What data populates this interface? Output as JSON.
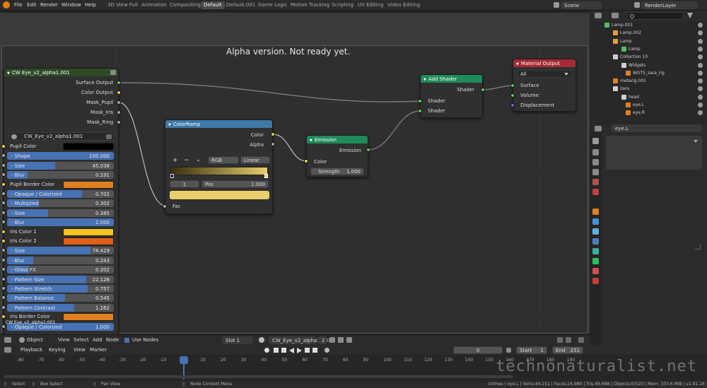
{
  "topbar": {
    "menus": [
      "File",
      "Edit",
      "Render",
      "Window",
      "Help"
    ],
    "workspaces": [
      "3D View Full",
      "Animation",
      "Compositing",
      "Default",
      "Default.001",
      "Game Logic",
      "Motion Tracking",
      "Scripting",
      "UV Editing",
      "Video Editing"
    ],
    "active_workspace": "Default",
    "scene": "Scene",
    "render_layer": "RenderLayer"
  },
  "editor": {
    "banner": "Alpha version. Not ready yet.",
    "header": {
      "mode": "Object",
      "view": "View",
      "select": "Select",
      "add": "Add",
      "node": "Node",
      "use_nodes": "Use Nodes",
      "slot": "Slot 1",
      "material": "CW_Eye_v2_alpha1.001",
      "users": "2"
    }
  },
  "group_node": {
    "title": "CW Eye_v2_alpha1.001",
    "outputs": [
      "Surface Output",
      "Color Output",
      "Mask_Pupil",
      "Mask_Iris",
      "Mask_Ring"
    ],
    "datablock": "CW_Eye_v2_alpha1.001",
    "props": [
      {
        "type": "color",
        "label": "Pupil Color",
        "color": "#000000"
      },
      {
        "type": "slider",
        "label": "- Shape",
        "value": "100.000",
        "fill": 1.0
      },
      {
        "type": "slider",
        "label": "- Size",
        "value": "45.038",
        "fill": 0.45
      },
      {
        "type": "slider",
        "label": "- Blur",
        "value": "0.191",
        "fill": 0.19
      },
      {
        "type": "color",
        "label": "Pupil Border Color",
        "color": "#e08020"
      },
      {
        "type": "slider",
        "label": "- Opaque / Colorized",
        "value": "0.702",
        "fill": 0.7
      },
      {
        "type": "slider",
        "label": "- Multiplied",
        "value": "0.302",
        "fill": 0.3
      },
      {
        "type": "slider",
        "label": "- Size",
        "value": "0.385",
        "fill": 0.385
      },
      {
        "type": "slider",
        "label": "- Blur",
        "value": "2.000",
        "fill": 1.0
      },
      {
        "type": "color",
        "label": "Iris Color 1",
        "color": "#f4c420"
      },
      {
        "type": "color",
        "label": "Iris Color 2",
        "color": "#e06018"
      },
      {
        "type": "slider",
        "label": "- Size",
        "value": "78.429",
        "fill": 0.78
      },
      {
        "type": "slider",
        "label": "- Blur",
        "value": "0.243",
        "fill": 0.243
      },
      {
        "type": "slider",
        "label": "- Glass FX",
        "value": "0.202",
        "fill": 0.202
      },
      {
        "type": "slider",
        "label": "- Pattern Size",
        "value": "22.128",
        "fill": 0.74
      },
      {
        "type": "slider",
        "label": "- Pattern Stretch",
        "value": "0.757",
        "fill": 0.757
      },
      {
        "type": "slider",
        "label": "- Pattern Balance",
        "value": "0.545",
        "fill": 0.545
      },
      {
        "type": "slider",
        "label": "- Pattern Contrast",
        "value": "1.262",
        "fill": 0.63
      },
      {
        "type": "color",
        "label": "Iris Border Color",
        "color": "#e08020"
      },
      {
        "type": "slider",
        "label": "- Opaque / Colorized",
        "value": "1.000",
        "fill": 1.0
      }
    ]
  },
  "colorramp_node": {
    "title": "ColorRamp",
    "out_color": "Color",
    "out_alpha": "Alpha",
    "mode": "RGB",
    "interp": "Linear",
    "index": "1",
    "pos_label": "Pos",
    "pos_value": "1.000",
    "in_fac": "Fac",
    "plus": "+",
    "minus": "−",
    "chevron": "⌄"
  },
  "emission_node": {
    "title": "Emission",
    "output": "Emission",
    "in_color": "Color",
    "strength_label": "Strength",
    "strength_value": "1.000"
  },
  "addshader_node": {
    "title": "Add Shader",
    "output": "Shader",
    "in1": "Shader",
    "in2": "Shader"
  },
  "matout_node": {
    "title": "Material Output",
    "target": "All",
    "in_surface": "Surface",
    "in_volume": "Volume",
    "in_disp": "Displacement"
  },
  "outliner": {
    "rows": [
      {
        "label": "Lamp.001",
        "indent": 30,
        "kind": "lamp-data"
      },
      {
        "label": "Lamp.002",
        "indent": 42,
        "kind": "lamp"
      },
      {
        "label": "Lamp",
        "indent": 42,
        "kind": "lamp"
      },
      {
        "label": "Lamp",
        "indent": 54,
        "kind": "lamp-data"
      },
      {
        "label": "Collection 10",
        "indent": 42,
        "kind": "collection"
      },
      {
        "label": "Widgets",
        "indent": 54,
        "kind": "collection"
      },
      {
        "label": "WGTS_zara_rig",
        "indent": 60,
        "kind": "armature"
      },
      {
        "label": "metarig.001",
        "indent": 42,
        "kind": "armature"
      },
      {
        "label": "zara",
        "indent": 42,
        "kind": "collection"
      },
      {
        "label": "head",
        "indent": 54,
        "kind": "collection"
      },
      {
        "label": "eye.L",
        "indent": 60,
        "kind": "mesh"
      },
      {
        "label": "eye.R",
        "indent": 60,
        "kind": "mesh"
      }
    ],
    "search_placeholder": ""
  },
  "properties": {
    "object_name": "eye.L"
  },
  "timeline": {
    "playback": "Playback",
    "keying": "Keying",
    "view": "View",
    "marker": "Marker",
    "current_frame": "0",
    "start_label": "Start",
    "start": "1",
    "end_label": "End",
    "end": "251",
    "ticks": [
      "-80",
      "-70",
      "-60",
      "-50",
      "-40",
      "-30",
      "-20",
      "-10",
      "0",
      "10",
      "20",
      "30",
      "40",
      "50",
      "60",
      "70",
      "80",
      "90",
      "100",
      "110",
      "120",
      "130",
      "140",
      "150",
      "160",
      "170",
      "180",
      "190"
    ]
  },
  "statusbar": {
    "select": "Select",
    "box_select": "Box Select",
    "pan_view": "Pan View",
    "node_context": "Node Context Menu",
    "stats": "clothes | eye.L | Verts:44,151 | Faces:24,980 | Tris:49,688 | Objects:0/520 | Mem: 333.6 MiB | v2.81.16"
  },
  "watermark": "technonaturalist.net",
  "colors": {
    "group_header": "#2e4a27",
    "colorramp_header": "#3e79a8",
    "shader_header": "#1f8a5a",
    "output_header": "#a52a35",
    "slider_fill": "#4772b3"
  }
}
